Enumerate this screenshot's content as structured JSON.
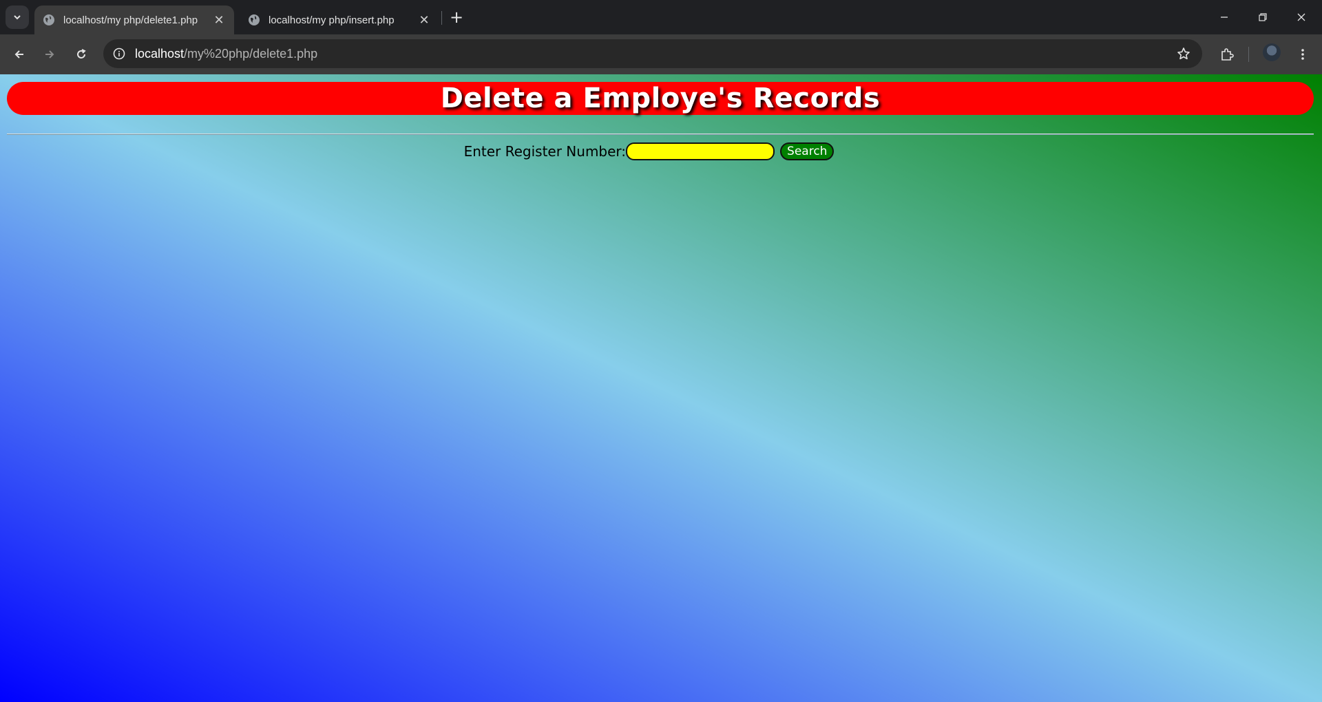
{
  "browser": {
    "tabs": [
      {
        "title": "localhost/my php/delete1.php",
        "active": true
      },
      {
        "title": "localhost/my php/insert.php",
        "active": false
      }
    ],
    "address": {
      "host": "localhost",
      "path": "/my%20php/delete1.php"
    },
    "icons": {
      "tab_search": "chevron-down-icon",
      "tab_favicon": "globe-icon",
      "tab_close": "close-icon",
      "new_tab": "plus-icon",
      "back": "arrow-left-icon",
      "forward": "arrow-right-icon",
      "reload": "reload-icon",
      "site_info": "info-icon",
      "bookmark": "star-icon",
      "extensions": "puzzle-icon",
      "profile": "avatar",
      "menu": "kebab-menu-icon",
      "minimize": "minimize-icon",
      "restore": "restore-icon",
      "close_window": "close-icon"
    }
  },
  "page": {
    "heading": "Delete a Employe's Records",
    "form": {
      "label": "Enter Register Number:",
      "input_value": "",
      "submit_label": "Search"
    },
    "colors": {
      "banner": "#ff0000",
      "input_bg": "#ffff00",
      "button_bg": "#008000",
      "gradient": [
        "#0000ff",
        "#87ceeb",
        "#008000"
      ]
    }
  }
}
